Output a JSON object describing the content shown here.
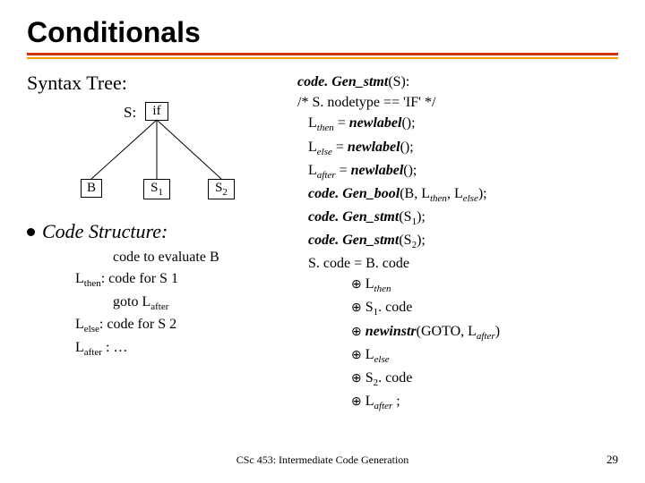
{
  "title": "Conditionals",
  "left": {
    "syntax_heading": "Syntax Tree:",
    "s_label": "S:",
    "node_if": "if",
    "node_b": "B",
    "node_s1_pre": "S",
    "node_s1_sub": "1",
    "node_s2_pre": "S",
    "node_s2_sub": "2",
    "cs_heading": "Code Structure:",
    "struct": {
      "l1": "code to evaluate B",
      "lthen_lbl": "L",
      "lthen_sub": "then",
      "lthen_txt": ": code for S 1",
      "goto_pre": "goto L",
      "goto_sub": "after",
      "lelse_lbl": "L",
      "lelse_sub": "else",
      "lelse_txt": ": code for S 2",
      "lafter_lbl": "L",
      "lafter_sub": "after",
      "lafter_txt": " : …"
    }
  },
  "right": {
    "l1a": "code. Gen_stmt",
    "l1b": "(S):",
    "l2": "/* S. nodetype == 'IF' */",
    "l3a": "L",
    "l3s": "then",
    "l3b": " = ",
    "l3c": "newlabel",
    "l3d": "();",
    "l4a": "L",
    "l4s": "else",
    "l4b": " = ",
    "l4c": "newlabel",
    "l4d": "();",
    "l5a": "L",
    "l5s": "after",
    "l5b": " = ",
    "l5c": "newlabel",
    "l5d": "();",
    "l6a": "code. Gen_bool",
    "l6b": "(B, L",
    "l6s1": "then",
    "l6c": ", L",
    "l6s2": "else",
    "l6d": ");",
    "l7a": "code. Gen_stmt",
    "l7b": "(S",
    "l7s": "1",
    "l7c": ");",
    "l8a": "code. Gen_stmt",
    "l8b": "(S",
    "l8s": "2",
    "l8c": ");",
    "l9": "S. code = B. code",
    "op": "⊕",
    "o1a": " L",
    "o1s": "then",
    "o2a": " S",
    "o2s": "1",
    "o2b": ". code",
    "o3a": " ",
    "o3b": "newinstr",
    "o3c": "(GOTO, L",
    "o3s": "after",
    "o3d": ")",
    "o4a": " L",
    "o4s": "else",
    "o5a": " S",
    "o5s": "2",
    "o5b": ". code",
    "o6a": " L",
    "o6s": "after",
    "o6b": " ;"
  },
  "footer": {
    "center": "CSc 453: Intermediate Code Generation",
    "num": "29"
  }
}
